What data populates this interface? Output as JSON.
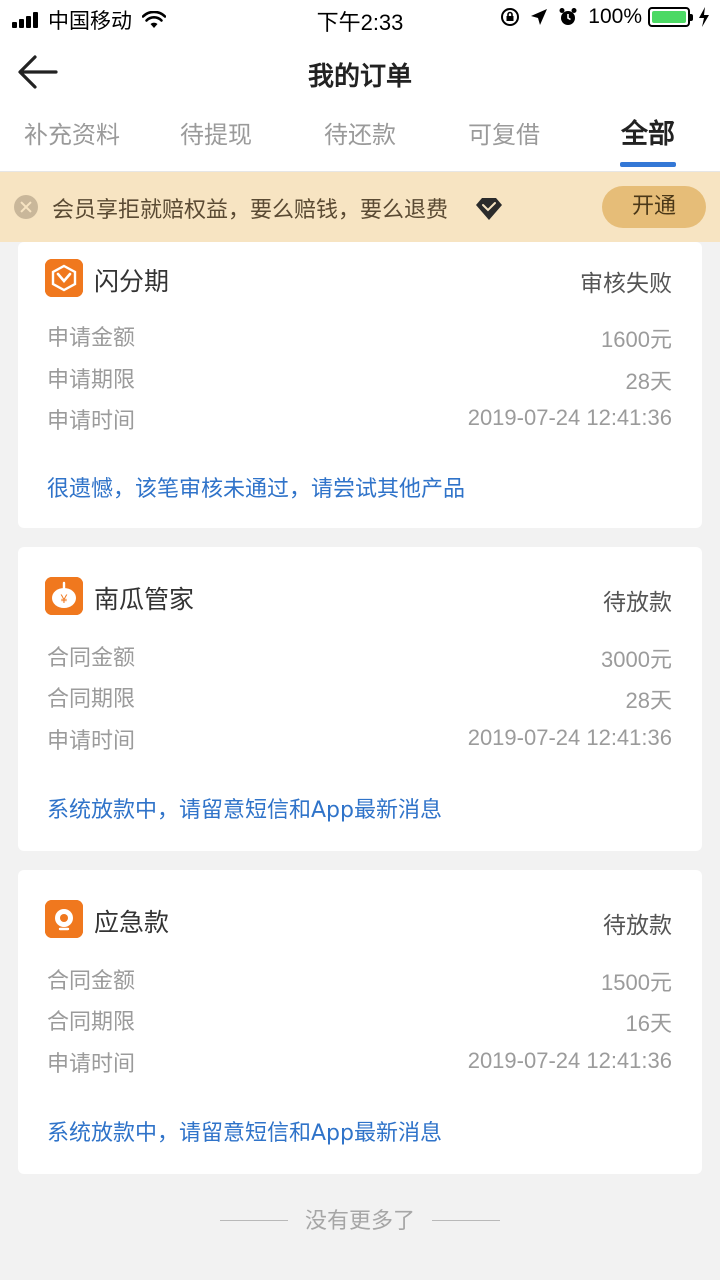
{
  "status_bar": {
    "carrier": "中国移动",
    "time": "下午2:33",
    "battery": "100%"
  },
  "nav": {
    "title": "我的订单"
  },
  "tabs": [
    {
      "label": "补充资料",
      "active": false
    },
    {
      "label": "待提现",
      "active": false
    },
    {
      "label": "待还款",
      "active": false
    },
    {
      "label": "可复借",
      "active": false
    },
    {
      "label": "全部",
      "active": true
    }
  ],
  "banner": {
    "text": "会员享拒就赔权益，要么赔钱，要么退费",
    "button": "开通"
  },
  "orders": [
    {
      "name": "闪分期",
      "status": "审核失败",
      "rows": [
        {
          "label": "申请金额",
          "value": "1600元"
        },
        {
          "label": "申请期限",
          "value": "28天"
        },
        {
          "label": "申请时间",
          "value": "2019-07-24 12:41:36"
        }
      ],
      "message": "很遗憾，该笔审核未通过，请尝试其他产品"
    },
    {
      "name": "南瓜管家",
      "status": "待放款",
      "rows": [
        {
          "label": "合同金额",
          "value": "3000元"
        },
        {
          "label": "合同期限",
          "value": "28天"
        },
        {
          "label": "申请时间",
          "value": "2019-07-24 12:41:36"
        }
      ],
      "message": "系统放款中，请留意短信和App最新消息"
    },
    {
      "name": "应急款",
      "status": "待放款",
      "rows": [
        {
          "label": "合同金额",
          "value": "1500元"
        },
        {
          "label": "合同期限",
          "value": "16天"
        },
        {
          "label": "申请时间",
          "value": "2019-07-24 12:41:36"
        }
      ],
      "message": "系统放款中，请留意短信和App最新消息"
    }
  ],
  "footer": {
    "text": "没有更多了"
  },
  "colors": {
    "accent": "#3478d6",
    "link": "#2f73c9",
    "banner_bg": "#f7e4c2",
    "banner_button": "#e6bd78",
    "logo_orange": "#f0781e"
  }
}
